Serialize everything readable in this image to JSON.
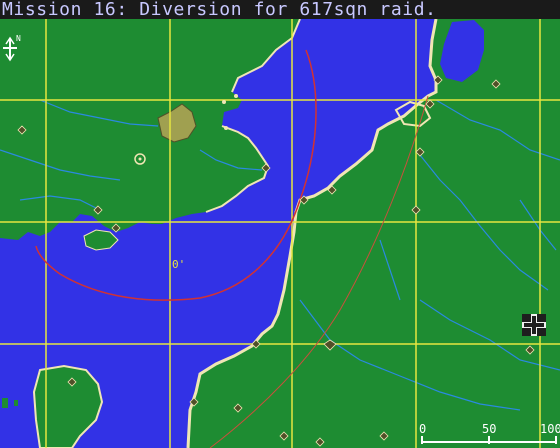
{
  "title": "Mission 16: Diversion for 617sqn raid.",
  "compass": {
    "icon": "compass-north-icon",
    "label": "N"
  },
  "scale": {
    "ticks": [
      "0",
      "50",
      "100"
    ]
  },
  "colors": {
    "sea": "#3232e6",
    "land": "#1e8c32",
    "grid": "#e6e640",
    "route": "#d23232",
    "river": "#2a8ae0",
    "beach": "#f0e6b4"
  },
  "markers": {
    "target": "target-icon",
    "enemy_base": "iron-cross-icon",
    "waypoint": "waypoint-diamond-icon",
    "town": "town-blob-icon"
  }
}
